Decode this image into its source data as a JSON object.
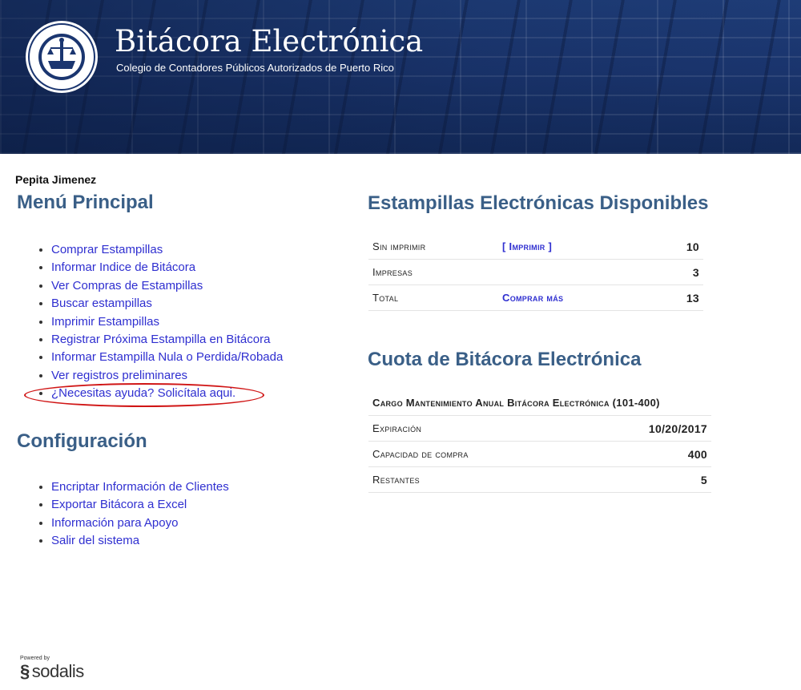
{
  "header": {
    "title": "Bitácora Electrónica",
    "subtitle": "Colegio de Contadores Públicos Autorizados de Puerto Rico",
    "logo_icon": "seal-logo-icon"
  },
  "user": {
    "name": "Pepita Jimenez"
  },
  "menu_principal": {
    "heading": "Menú Principal",
    "items": [
      "Comprar Estampillas",
      "Informar Indice de Bitácora",
      "Ver Compras de Estampillas",
      "Buscar estampillas",
      "Imprimir Estampillas",
      "Registrar Próxima Estampilla en Bitácora",
      "Informar Estampilla Nula o Perdida/Robada",
      "Ver registros preliminares",
      "¿Necesitas ayuda? Solicítala aqui."
    ]
  },
  "configuracion": {
    "heading": "Configuración",
    "items": [
      "Encriptar Información de Clientes",
      "Exportar Bitácora a Excel",
      "Información para Apoyo",
      "Salir del sistema"
    ]
  },
  "estampillas": {
    "heading": "Estampillas Electrónicas Disponibles",
    "rows": [
      {
        "label": "Sin imprimir",
        "action": "[ Imprimir ]",
        "value": "10"
      },
      {
        "label": "Impresas",
        "action": "",
        "value": "3"
      },
      {
        "label": "Total",
        "action": "Comprar más",
        "value": "13"
      }
    ]
  },
  "cuota": {
    "heading": "Cuota de Bitácora Electrónica",
    "plan": "Cargo Mantenimiento Anual Bitácora Electrónica (101-400)",
    "rows": [
      {
        "label": "Expiración",
        "value": "10/20/2017"
      },
      {
        "label": "Capacidad de compra",
        "value": "400"
      },
      {
        "label": "Restantes",
        "value": "5"
      }
    ]
  },
  "footer": {
    "powered_by": "Powered by",
    "brand": "sodalis"
  },
  "colors": {
    "heading": "#3a5f87",
    "link": "#2f2fd0",
    "banner": "#1b3670",
    "highlight": "#d01515"
  }
}
